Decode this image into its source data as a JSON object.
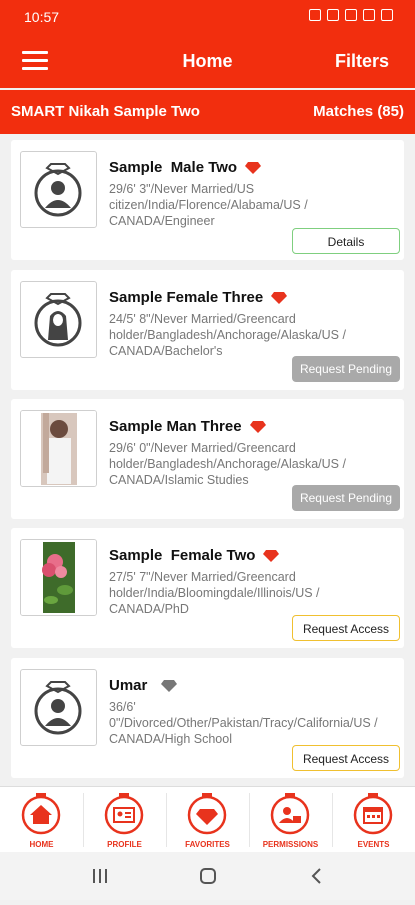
{
  "status_bar": {
    "time": "10:57"
  },
  "app_bar": {
    "title": "Home",
    "filters_label": "Filters"
  },
  "sub_bar": {
    "account_name": "SMART Nikah Sample Two",
    "matches_label": "Matches (85)"
  },
  "profiles": [
    {
      "name": "Sample  Male Two",
      "description": "29/6' 3\"/Never Married/US citizen/India/Florence/Alabama/US / CANADA/Engineer",
      "button": "Details",
      "photo": "male-avatar-icon",
      "gem_color": "#e8331d"
    },
    {
      "name": "Sample Female Three",
      "description": "24/5' 8\"/Never Married/Greencard holder/Bangladesh/Anchorage/Alaska/US / CANADA/Bachelor's",
      "button": "Request Pending",
      "photo": "female-avatar-icon",
      "gem_color": "#e8331d"
    },
    {
      "name": "Sample Man Three",
      "description": "29/6' 0\"/Never Married/Greencard holder/Bangladesh/Anchorage/Alaska/US / CANADA/Islamic Studies",
      "button": "Request Pending",
      "photo": "man-photo",
      "gem_color": "#e8331d"
    },
    {
      "name": "Sample  Female Two",
      "description": "27/5' 7\"/Never Married/Greencard holder/India/Bloomingdale/Illinois/US / CANADA/PhD",
      "button": "Request Access",
      "photo": "flower-photo",
      "gem_color": "#e8331d"
    },
    {
      "name": "Umar",
      "description": "36/6' 0\"/Divorced/Other/Pakistan/Tracy/California/US / CANADA/High School",
      "button": "Request Access",
      "photo": "male-avatar-icon",
      "gem_color": "#777777"
    }
  ],
  "bottom_nav": [
    {
      "label": "HOME",
      "icon": "home-icon"
    },
    {
      "label": "PROFILE",
      "icon": "id-card-icon"
    },
    {
      "label": "FAVORITES",
      "icon": "diamond-icon"
    },
    {
      "label": "PERMISSIONS",
      "icon": "user-lock-icon"
    },
    {
      "label": "EVENTS",
      "icon": "calendar-icon"
    }
  ],
  "colors": {
    "brand": "#f22e0e",
    "details_border": "#7fcf7f",
    "access_border": "#f0c030",
    "pending_bg": "#a9a9a9"
  }
}
